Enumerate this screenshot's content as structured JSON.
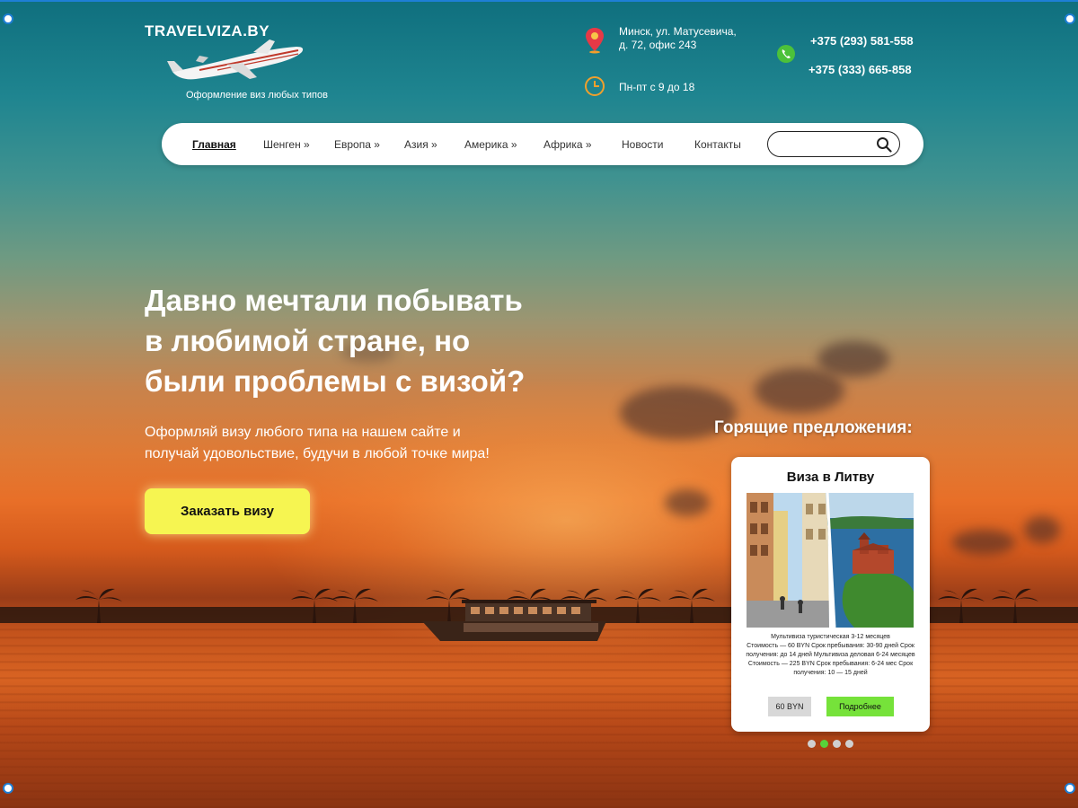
{
  "header": {
    "logo": "TRAVELVIZA.BY",
    "tagline": "Оформление виз любых типов",
    "address_line1": "Минск, ул. Матусевича,",
    "address_line2": "д. 72, офис 243",
    "hours": "Пн-пт с 9 до 18",
    "phone1": "+375 (293) 581-558",
    "phone2": "+375 (333) 665-858"
  },
  "nav": {
    "items": [
      {
        "label": "Главная"
      },
      {
        "label": "Шенген »"
      },
      {
        "label": "Европа »"
      },
      {
        "label": "Азия »"
      },
      {
        "label": "Америка »"
      },
      {
        "label": "Африка »"
      },
      {
        "label": "Новости"
      },
      {
        "label": "Контакты"
      }
    ],
    "search_placeholder": ""
  },
  "hero": {
    "title_lines": [
      "Давно мечтали побывать",
      "в любимой стране, но",
      "были проблемы с визой?"
    ],
    "subtitle_lines": [
      "Оформляй визу любого типа на нашем сайте и",
      "получай удовольствие, будучи в любой точке мира!"
    ],
    "cta_label": "Заказать визу"
  },
  "offers": {
    "heading": "Горящие предложения:",
    "card": {
      "title": "Виза в Литву",
      "description_lines": [
        "Мультивиза туристическая 3-12 месяцев",
        "Стоимость — 60 BYN Срок пребывания: 30-90 дней Срок",
        "получения: до 14 дней Мультивиза деловая 6-24 месяцев",
        "Стоимость — 225 BYN Срок пребывания: 6-24 мес Срок",
        "получения: 10 — 15 дней"
      ],
      "price": "60 BYN",
      "more_label": "Подробнее"
    },
    "carousel_active_index": 1,
    "carousel_count": 4
  },
  "colors": {
    "cta": "#f6f551",
    "more_button": "#76e23a",
    "carousel_active": "#58d43a",
    "location_icon": "#e63946",
    "phone_icon": "#4cc13a",
    "clock_icon": "#f0a02c"
  }
}
